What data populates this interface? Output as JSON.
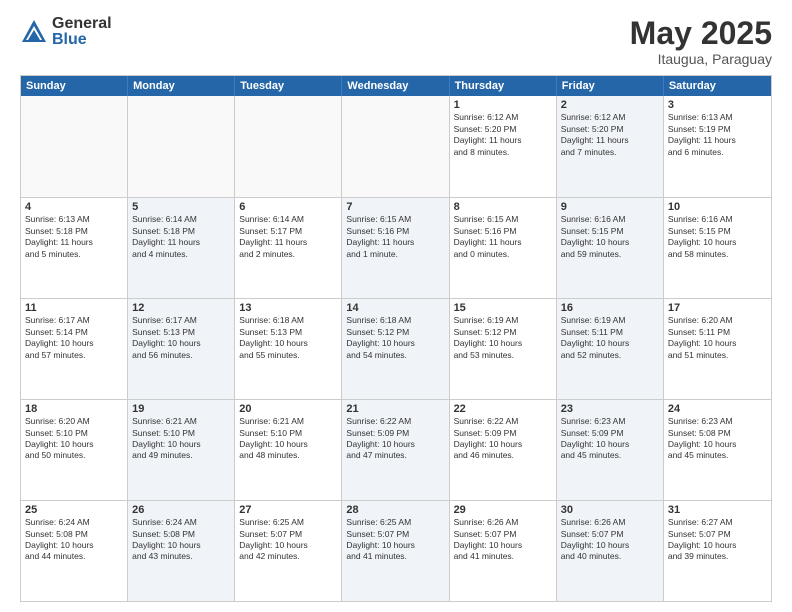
{
  "header": {
    "logo_general": "General",
    "logo_blue": "Blue",
    "month_title": "May 2025",
    "location": "Itaugua, Paraguay"
  },
  "weekdays": [
    "Sunday",
    "Monday",
    "Tuesday",
    "Wednesday",
    "Thursday",
    "Friday",
    "Saturday"
  ],
  "weeks": [
    [
      {
        "day": "",
        "info": "",
        "shaded": false,
        "empty": true
      },
      {
        "day": "",
        "info": "",
        "shaded": false,
        "empty": true
      },
      {
        "day": "",
        "info": "",
        "shaded": false,
        "empty": true
      },
      {
        "day": "",
        "info": "",
        "shaded": false,
        "empty": true
      },
      {
        "day": "1",
        "info": "Sunrise: 6:12 AM\nSunset: 5:20 PM\nDaylight: 11 hours\nand 8 minutes.",
        "shaded": false,
        "empty": false
      },
      {
        "day": "2",
        "info": "Sunrise: 6:12 AM\nSunset: 5:20 PM\nDaylight: 11 hours\nand 7 minutes.",
        "shaded": true,
        "empty": false
      },
      {
        "day": "3",
        "info": "Sunrise: 6:13 AM\nSunset: 5:19 PM\nDaylight: 11 hours\nand 6 minutes.",
        "shaded": false,
        "empty": false
      }
    ],
    [
      {
        "day": "4",
        "info": "Sunrise: 6:13 AM\nSunset: 5:18 PM\nDaylight: 11 hours\nand 5 minutes.",
        "shaded": false,
        "empty": false
      },
      {
        "day": "5",
        "info": "Sunrise: 6:14 AM\nSunset: 5:18 PM\nDaylight: 11 hours\nand 4 minutes.",
        "shaded": true,
        "empty": false
      },
      {
        "day": "6",
        "info": "Sunrise: 6:14 AM\nSunset: 5:17 PM\nDaylight: 11 hours\nand 2 minutes.",
        "shaded": false,
        "empty": false
      },
      {
        "day": "7",
        "info": "Sunrise: 6:15 AM\nSunset: 5:16 PM\nDaylight: 11 hours\nand 1 minute.",
        "shaded": true,
        "empty": false
      },
      {
        "day": "8",
        "info": "Sunrise: 6:15 AM\nSunset: 5:16 PM\nDaylight: 11 hours\nand 0 minutes.",
        "shaded": false,
        "empty": false
      },
      {
        "day": "9",
        "info": "Sunrise: 6:16 AM\nSunset: 5:15 PM\nDaylight: 10 hours\nand 59 minutes.",
        "shaded": true,
        "empty": false
      },
      {
        "day": "10",
        "info": "Sunrise: 6:16 AM\nSunset: 5:15 PM\nDaylight: 10 hours\nand 58 minutes.",
        "shaded": false,
        "empty": false
      }
    ],
    [
      {
        "day": "11",
        "info": "Sunrise: 6:17 AM\nSunset: 5:14 PM\nDaylight: 10 hours\nand 57 minutes.",
        "shaded": false,
        "empty": false
      },
      {
        "day": "12",
        "info": "Sunrise: 6:17 AM\nSunset: 5:13 PM\nDaylight: 10 hours\nand 56 minutes.",
        "shaded": true,
        "empty": false
      },
      {
        "day": "13",
        "info": "Sunrise: 6:18 AM\nSunset: 5:13 PM\nDaylight: 10 hours\nand 55 minutes.",
        "shaded": false,
        "empty": false
      },
      {
        "day": "14",
        "info": "Sunrise: 6:18 AM\nSunset: 5:12 PM\nDaylight: 10 hours\nand 54 minutes.",
        "shaded": true,
        "empty": false
      },
      {
        "day": "15",
        "info": "Sunrise: 6:19 AM\nSunset: 5:12 PM\nDaylight: 10 hours\nand 53 minutes.",
        "shaded": false,
        "empty": false
      },
      {
        "day": "16",
        "info": "Sunrise: 6:19 AM\nSunset: 5:11 PM\nDaylight: 10 hours\nand 52 minutes.",
        "shaded": true,
        "empty": false
      },
      {
        "day": "17",
        "info": "Sunrise: 6:20 AM\nSunset: 5:11 PM\nDaylight: 10 hours\nand 51 minutes.",
        "shaded": false,
        "empty": false
      }
    ],
    [
      {
        "day": "18",
        "info": "Sunrise: 6:20 AM\nSunset: 5:10 PM\nDaylight: 10 hours\nand 50 minutes.",
        "shaded": false,
        "empty": false
      },
      {
        "day": "19",
        "info": "Sunrise: 6:21 AM\nSunset: 5:10 PM\nDaylight: 10 hours\nand 49 minutes.",
        "shaded": true,
        "empty": false
      },
      {
        "day": "20",
        "info": "Sunrise: 6:21 AM\nSunset: 5:10 PM\nDaylight: 10 hours\nand 48 minutes.",
        "shaded": false,
        "empty": false
      },
      {
        "day": "21",
        "info": "Sunrise: 6:22 AM\nSunset: 5:09 PM\nDaylight: 10 hours\nand 47 minutes.",
        "shaded": true,
        "empty": false
      },
      {
        "day": "22",
        "info": "Sunrise: 6:22 AM\nSunset: 5:09 PM\nDaylight: 10 hours\nand 46 minutes.",
        "shaded": false,
        "empty": false
      },
      {
        "day": "23",
        "info": "Sunrise: 6:23 AM\nSunset: 5:09 PM\nDaylight: 10 hours\nand 45 minutes.",
        "shaded": true,
        "empty": false
      },
      {
        "day": "24",
        "info": "Sunrise: 6:23 AM\nSunset: 5:08 PM\nDaylight: 10 hours\nand 45 minutes.",
        "shaded": false,
        "empty": false
      }
    ],
    [
      {
        "day": "25",
        "info": "Sunrise: 6:24 AM\nSunset: 5:08 PM\nDaylight: 10 hours\nand 44 minutes.",
        "shaded": false,
        "empty": false
      },
      {
        "day": "26",
        "info": "Sunrise: 6:24 AM\nSunset: 5:08 PM\nDaylight: 10 hours\nand 43 minutes.",
        "shaded": true,
        "empty": false
      },
      {
        "day": "27",
        "info": "Sunrise: 6:25 AM\nSunset: 5:07 PM\nDaylight: 10 hours\nand 42 minutes.",
        "shaded": false,
        "empty": false
      },
      {
        "day": "28",
        "info": "Sunrise: 6:25 AM\nSunset: 5:07 PM\nDaylight: 10 hours\nand 41 minutes.",
        "shaded": true,
        "empty": false
      },
      {
        "day": "29",
        "info": "Sunrise: 6:26 AM\nSunset: 5:07 PM\nDaylight: 10 hours\nand 41 minutes.",
        "shaded": false,
        "empty": false
      },
      {
        "day": "30",
        "info": "Sunrise: 6:26 AM\nSunset: 5:07 PM\nDaylight: 10 hours\nand 40 minutes.",
        "shaded": true,
        "empty": false
      },
      {
        "day": "31",
        "info": "Sunrise: 6:27 AM\nSunset: 5:07 PM\nDaylight: 10 hours\nand 39 minutes.",
        "shaded": false,
        "empty": false
      }
    ]
  ]
}
